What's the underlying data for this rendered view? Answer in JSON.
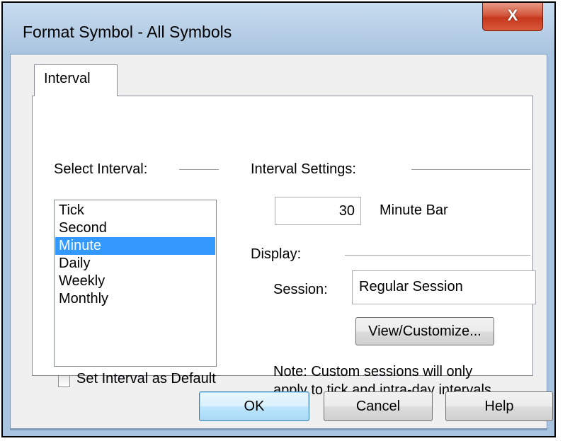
{
  "window": {
    "title": "Format Symbol - All Symbols",
    "close_glyph": "X"
  },
  "tabs": [
    {
      "label": "Interval",
      "active": true
    }
  ],
  "select_interval": {
    "label": "Select Interval:",
    "items": [
      "Tick",
      "Second",
      "Minute",
      "Daily",
      "Weekly",
      "Monthly"
    ],
    "selected": "Minute",
    "default_checkbox": {
      "label": "Set Interval as Default",
      "checked": false
    }
  },
  "interval_settings": {
    "label": "Interval Settings:",
    "value": "30",
    "unit_label": "Minute Bar"
  },
  "display": {
    "label": "Display:",
    "session_label": "Session:",
    "session_value": "Regular Session",
    "customize_button": "View/Customize...",
    "note_line1": "Note: Custom sessions will only",
    "note_line2": "apply to tick and intra-day intervals."
  },
  "buttons": {
    "ok": "OK",
    "cancel": "Cancel",
    "help": "Help"
  },
  "colors": {
    "selection": "#3399ff",
    "close_button": "#c7381e",
    "title_bar": "#b9d1ea"
  }
}
